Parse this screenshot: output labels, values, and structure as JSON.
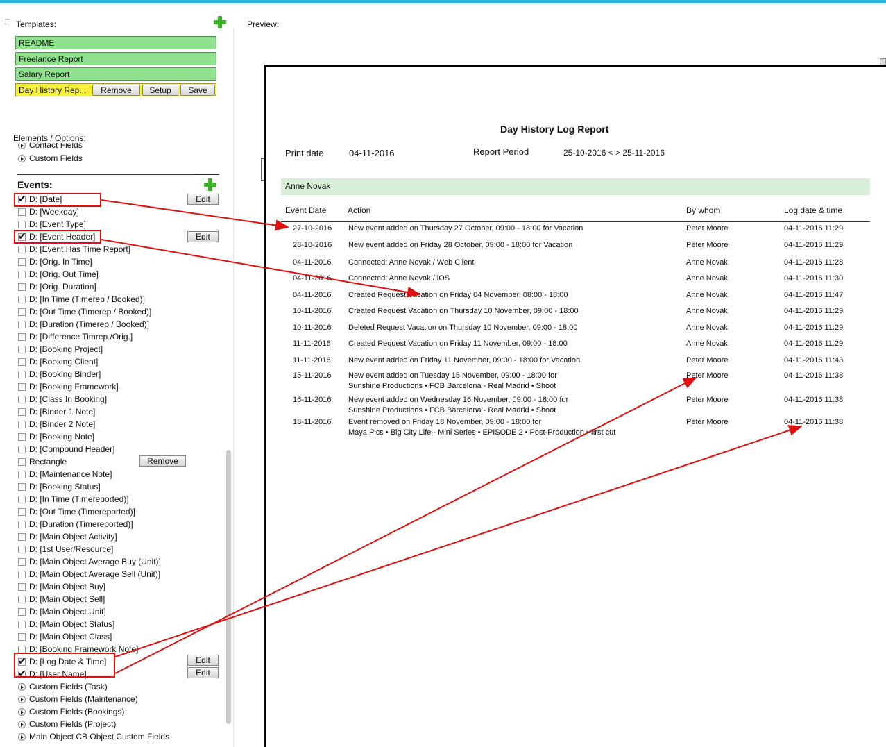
{
  "templates_label": "Templates:",
  "preview_label": "Preview:",
  "templates": [
    {
      "label": "README"
    },
    {
      "label": "Freelance Report"
    },
    {
      "label": "Salary Report"
    },
    {
      "label": "Day History Rep..."
    }
  ],
  "template_buttons": {
    "remove": "Remove",
    "setup": "Setup",
    "save": "Save"
  },
  "elements_label": "Elements / Options:",
  "contact_fields": "Contact Fields",
  "custom_fields": "Custom Fields",
  "events_label": "Events:",
  "edit_label": "Edit",
  "remove_label": "Remove",
  "event_items": [
    {
      "label": "D: [Date]",
      "checked": true
    },
    {
      "label": "D: [Weekday]",
      "checked": false
    },
    {
      "label": "D: [Event Type]",
      "checked": false
    },
    {
      "label": "D: [Event Header]",
      "checked": true
    },
    {
      "label": "D: [Event Has Time Report]",
      "checked": false
    },
    {
      "label": "D: [Orig. In Time]",
      "checked": false
    },
    {
      "label": "D: [Orig. Out Time]",
      "checked": false
    },
    {
      "label": "D: [Orig. Duration]",
      "checked": false
    },
    {
      "label": "D: [In Time (Timerep / Booked)]",
      "checked": false
    },
    {
      "label": "D: [Out Time (Timerep / Booked)]",
      "checked": false
    },
    {
      "label": "D: [Duration (Timerep / Booked)]",
      "checked": false
    },
    {
      "label": "D: [Difference Timrep./Orig.]",
      "checked": false
    },
    {
      "label": "D: [Booking Project]",
      "checked": false
    },
    {
      "label": "D: [Booking Client]",
      "checked": false
    },
    {
      "label": "D: [Booking Binder]",
      "checked": false
    },
    {
      "label": "D: [Booking Framework]",
      "checked": false
    },
    {
      "label": "D: [Class In Booking]",
      "checked": false
    },
    {
      "label": "D: [Binder 1 Note]",
      "checked": false
    },
    {
      "label": "D: [Binder 2 Note]",
      "checked": false
    },
    {
      "label": "D: [Booking Note]",
      "checked": false
    },
    {
      "label": "D: [Compound Header]",
      "checked": false
    },
    {
      "label": "Rectangle",
      "checked": false
    },
    {
      "label": "D: [Maintenance Note]",
      "checked": false
    },
    {
      "label": "D: [Booking Status]",
      "checked": false
    },
    {
      "label": "D: [In Time (Timereported)]",
      "checked": false
    },
    {
      "label": "D: [Out Time (Timereported)]",
      "checked": false
    },
    {
      "label": "D: [Duration (Timereported)]",
      "checked": false
    },
    {
      "label": "D: [Main Object Activity]",
      "checked": false
    },
    {
      "label": "D: [1st User/Resource]",
      "checked": false
    },
    {
      "label": "D: [Main Object Average Buy (Unit)]",
      "checked": false
    },
    {
      "label": "D: [Main Object Average Sell (Unit)]",
      "checked": false
    },
    {
      "label": "D: [Main Object Buy]",
      "checked": false
    },
    {
      "label": "D: [Main Object Sell]",
      "checked": false
    },
    {
      "label": "D: [Main Object Unit]",
      "checked": false
    },
    {
      "label": "D: [Main Object Status]",
      "checked": false
    },
    {
      "label": "D: [Main Object Class]",
      "checked": false
    },
    {
      "label": "D: [Booking Framework Note]",
      "checked": false
    },
    {
      "label": "D: [Log Date & Time]",
      "checked": true
    },
    {
      "label": "D: [User Name]",
      "checked": true
    }
  ],
  "group_items": [
    "Custom Fields (Task)",
    "Custom Fields (Maintenance)",
    "Custom Fields (Bookings)",
    "Custom Fields (Project)",
    "Main Object CB Object Custom Fields"
  ],
  "report": {
    "title": "Day History Log Report",
    "print_date_label": "Print date",
    "print_date": "04-11-2016",
    "period_label": "Report Period",
    "period": "25-10-2016 < > 25-11-2016",
    "person": "Anne Novak",
    "headers": [
      "Event Date",
      "Action",
      "By whom",
      "Log date & time"
    ],
    "rows": [
      {
        "date": "27-10-2016",
        "action": "New event added on Thursday 27 October, 09:00 - 18:00 for Vacation",
        "action2": "",
        "who": "Peter Moore",
        "log": "04-11-2016 11:29"
      },
      {
        "date": "28-10-2016",
        "action": "New event added on Friday 28 October, 09:00 - 18:00 for Vacation",
        "action2": "",
        "who": "Peter Moore",
        "log": "04-11-2016 11:29"
      },
      {
        "date": "04-11-2016",
        "action": "Connected: Anne Novak / Web Client",
        "action2": "",
        "who": "Anne Novak",
        "log": "04-11-2016 11:28"
      },
      {
        "date": "04-11-2016",
        "action": "Connected: Anne Novak / iOS",
        "action2": "",
        "who": "Anne Novak",
        "log": "04-11-2016 11:30"
      },
      {
        "date": "04-11-2016",
        "action": "Created Request Vacation on Friday 04 November, 08:00 - 18:00",
        "action2": "",
        "who": "Anne Novak",
        "log": "04-11-2016 11:47"
      },
      {
        "date": "10-11-2016",
        "action": "Created Request Vacation on Thursday 10 November, 09:00 - 18:00",
        "action2": "",
        "who": "Anne Novak",
        "log": "04-11-2016 11:29"
      },
      {
        "date": "10-11-2016",
        "action": "Deleted Request Vacation on Thursday 10 November, 09:00 - 18:00",
        "action2": "",
        "who": "Anne Novak",
        "log": "04-11-2016 11:29"
      },
      {
        "date": "11-11-2016",
        "action": "Created Request Vacation on Friday 11 November, 09:00 - 18:00",
        "action2": "",
        "who": "Anne Novak",
        "log": "04-11-2016 11:29"
      },
      {
        "date": "11-11-2016",
        "action": "New event added on Friday 11 November, 09:00 - 18:00 for Vacation",
        "action2": "",
        "who": "Peter Moore",
        "log": "04-11-2016 11:43"
      },
      {
        "date": "15-11-2016",
        "action": "New event added on Tuesday 15 November, 09:00 - 18:00 for",
        "action2": "Sunshine Productions • FCB Barcelona - Real Madrid • Shoot",
        "who": "Peter Moore",
        "log": "04-11-2016 11:38"
      },
      {
        "date": "16-11-2016",
        "action": "New event added on Wednesday 16 November, 09:00 - 18:00 for",
        "action2": "Sunshine Productions • FCB Barcelona - Real Madrid • Shoot",
        "who": "Peter Moore",
        "log": "04-11-2016 11:38"
      },
      {
        "date": "18-11-2016",
        "action": "Event removed on Friday 18 November, 09:00 - 18:00 for",
        "action2": "Maya Pics • Big City Life - Mini Series • EPISODE 2 • Post-Production • first cut",
        "who": "Peter Moore",
        "log": "04-11-2016 11:38"
      }
    ]
  },
  "annotation_color": "#e01010"
}
